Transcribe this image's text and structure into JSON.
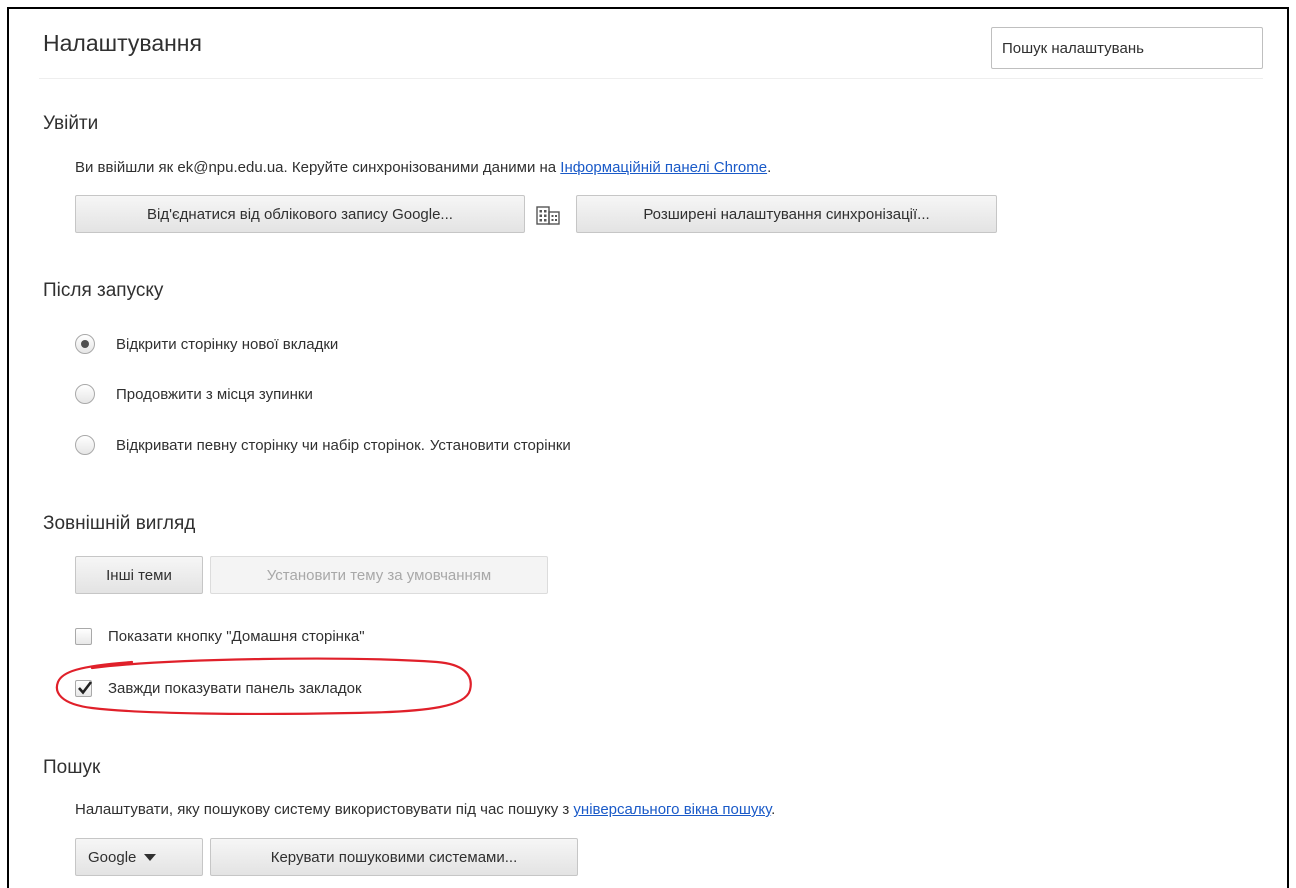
{
  "header": {
    "title": "Налаштування",
    "search_placeholder": "Пошук налаштувань"
  },
  "signin": {
    "heading": "Увійти",
    "text_before": "Ви ввійшли як ek@npu.edu.ua. Керуйте синхронізованими даними на ",
    "link": "Інформаційній панелі Chrome",
    "text_after": ".",
    "disconnect_button": "Від'єднатися від облікового запису Google...",
    "building_icon": "building-icon",
    "advanced_sync_button": "Розширені налаштування синхронізації..."
  },
  "startup": {
    "heading": "Після запуску",
    "options": [
      {
        "label": "Відкрити сторінку нової вкладки",
        "selected": true
      },
      {
        "label": "Продовжити з місця зупинки",
        "selected": false
      },
      {
        "label": "Відкривати певну сторінку чи набір сторінок.",
        "selected": false
      }
    ],
    "set_pages_link": "Установити сторінки"
  },
  "appearance": {
    "heading": "Зовнішній вигляд",
    "themes_button": "Інші теми",
    "reset_theme_button": "Установити тему за умовчанням",
    "show_home_button": {
      "label": "Показати кнопку \"Домашня сторінка\"",
      "checked": false
    },
    "show_bookmarks_bar": {
      "label": "Завжди показувати панель закладок",
      "checked": true
    },
    "annotation_color": "#e0202a"
  },
  "search": {
    "heading": "Пошук",
    "text_before": "Налаштувати, яку пошукову систему використовувати під час пошуку з ",
    "link": "універсального вікна пошуку",
    "text_after": ".",
    "engine_select": "Google",
    "manage_button": "Керувати пошуковими системами..."
  }
}
